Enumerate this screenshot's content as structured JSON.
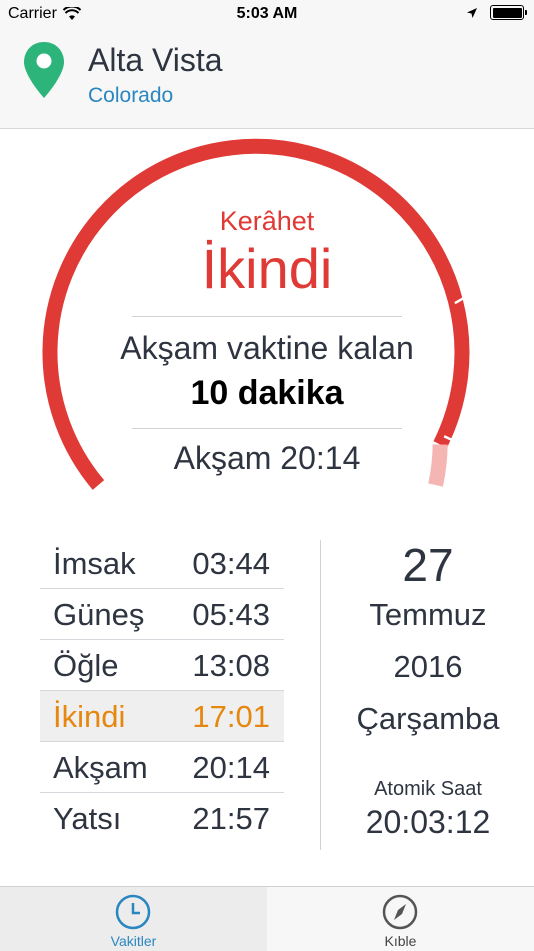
{
  "status_bar": {
    "carrier": "Carrier",
    "time": "5:03 AM"
  },
  "location": {
    "city": "Alta Vista",
    "region": "Colorado"
  },
  "current": {
    "status": "Kerâhet",
    "prayer": "İkindi",
    "remaining_label": "Akşam vaktine kalan",
    "remaining_value": "10 dakika",
    "next_prayer": "Akşam 20:14"
  },
  "prayer_times": [
    {
      "name": "İmsak",
      "time": "03:44",
      "active": false
    },
    {
      "name": "Güneş",
      "time": "05:43",
      "active": false
    },
    {
      "name": "Öğle",
      "time": "13:08",
      "active": false
    },
    {
      "name": "İkindi",
      "time": "17:01",
      "active": true
    },
    {
      "name": "Akşam",
      "time": "20:14",
      "active": false
    },
    {
      "name": "Yatsı",
      "time": "21:57",
      "active": false
    }
  ],
  "date": {
    "day": "27",
    "month": "Temmuz",
    "year": "2016",
    "weekday": "Çarşamba"
  },
  "atomic_clock": {
    "label": "Atomik Saat",
    "time": "20:03:12"
  },
  "tabs": [
    {
      "label": "Vakitler",
      "icon": "clock-icon",
      "selected": true
    },
    {
      "label": "Kıble",
      "icon": "compass-icon",
      "selected": false
    }
  ],
  "colors": {
    "accent_red": "#df3a35",
    "arc_light": "#f5b5b3",
    "active_orange": "#e6870f",
    "link_blue": "#2a86c0",
    "pin_green": "#2db47a"
  }
}
